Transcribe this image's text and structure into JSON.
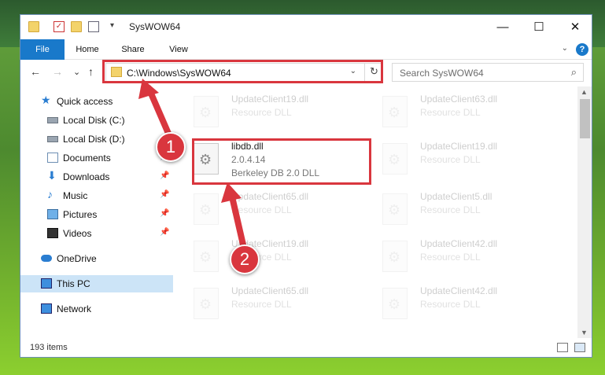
{
  "window": {
    "title": "SysWOW64",
    "controls": {
      "minimize": "—",
      "maximize": "☐",
      "close": "✕"
    }
  },
  "quick_access_toolbar": {
    "dropdown": "▾"
  },
  "ribbon": {
    "tabs": [
      {
        "label": "File",
        "active": true
      },
      {
        "label": "Home"
      },
      {
        "label": "Share"
      },
      {
        "label": "View"
      }
    ],
    "expand_icon": "⌄",
    "help_label": "?"
  },
  "nav": {
    "back": "←",
    "forward": "→",
    "recent": "⌄",
    "up": "↑",
    "address": "C:\\Windows\\SysWOW64",
    "address_dropdown": "⌄",
    "refresh": "↻",
    "search_placeholder": "Search SysWOW64",
    "search_icon": "⌕"
  },
  "sidebar": {
    "items": [
      {
        "label": "Quick access",
        "icon": "star-icon"
      },
      {
        "label": "Local Disk (C:)",
        "icon": "drive-icon"
      },
      {
        "label": "Local Disk (D:)",
        "icon": "drive-icon"
      },
      {
        "label": "Documents",
        "icon": "documents-icon",
        "pinned": true
      },
      {
        "label": "Downloads",
        "icon": "download-icon",
        "pinned": true
      },
      {
        "label": "Music",
        "icon": "music-icon",
        "pinned": true
      },
      {
        "label": "Pictures",
        "icon": "pictures-icon",
        "pinned": true
      },
      {
        "label": "Videos",
        "icon": "videos-icon",
        "pinned": true
      },
      {
        "label": "OneDrive",
        "icon": "cloud-icon"
      },
      {
        "label": "This PC",
        "icon": "pc-icon",
        "selected": true
      },
      {
        "label": "Network",
        "icon": "network-icon"
      }
    ],
    "pin_glyph": "📌"
  },
  "files": [
    {
      "name": "UpdateClient19.dll",
      "type": "Resource DLL",
      "faded": true
    },
    {
      "name": "UpdateClient63.dll",
      "type": "Resource DLL",
      "faded": true
    },
    {
      "name": "libdb.dll",
      "version": "2.0.4.14",
      "description": "Berkeley DB 2.0 DLL",
      "faded": false
    },
    {
      "name": "UpdateClient19.dll",
      "type": "Resource DLL",
      "faded": true
    },
    {
      "name": "UpdateClient65.dll",
      "type": "Resource DLL",
      "faded": true
    },
    {
      "name": "UpdateClient5.dll",
      "type": "Resource DLL",
      "faded": true
    },
    {
      "name": "UpdateClient19.dll",
      "type": "Resource DLL",
      "faded": true
    },
    {
      "name": "UpdateClient42.dll",
      "type": "Resource DLL",
      "faded": true
    },
    {
      "name": "UpdateClient65.dll",
      "type": "Resource DLL",
      "faded": true
    },
    {
      "name": "UpdateClient42.dll",
      "type": "Resource DLL",
      "faded": true
    }
  ],
  "file_icon_glyph": "⚙",
  "scrollbar": {
    "up": "▲",
    "down": "▼"
  },
  "status": {
    "count": "193 items"
  },
  "annotations": {
    "step1": "1",
    "step2": "2",
    "color": "#d9363e"
  }
}
